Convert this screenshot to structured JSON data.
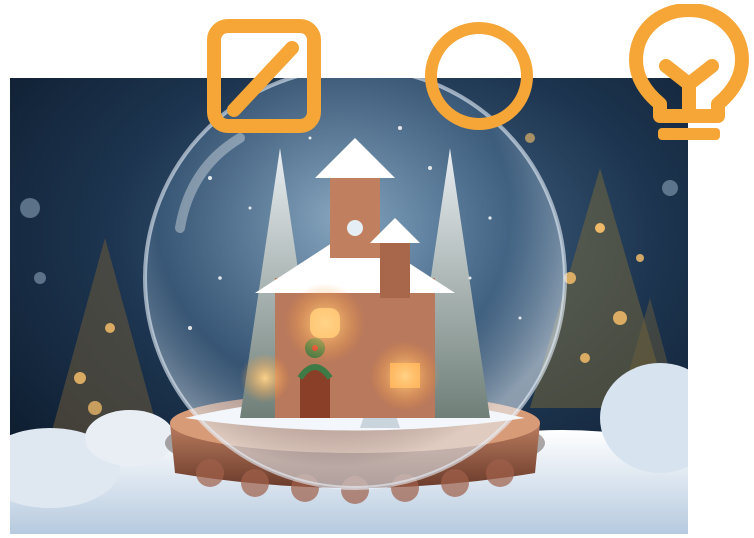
{
  "photo": {
    "subject": "snow-globe-icon"
  },
  "toolbar": {
    "accent_color": "#F5A637",
    "tools": [
      {
        "icon": "pencil-square-icon"
      },
      {
        "icon": "circle-icon"
      },
      {
        "icon": "lightbulb-icon"
      }
    ]
  }
}
